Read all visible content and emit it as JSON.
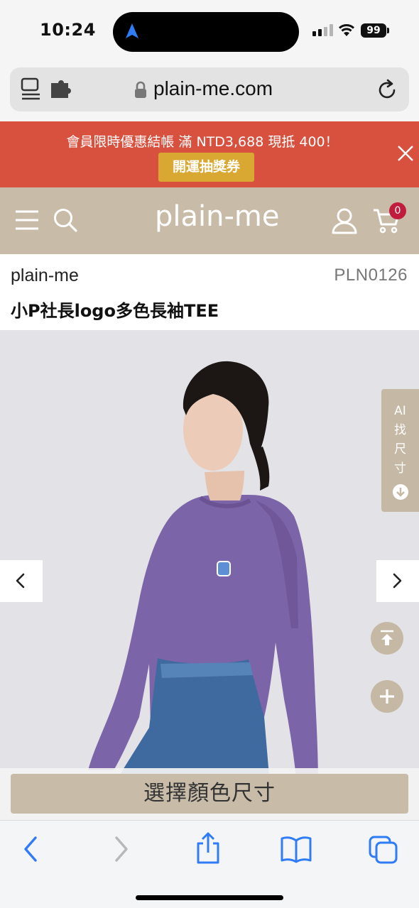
{
  "status_bar": {
    "time": "10:24",
    "battery": "99",
    "icons": [
      "location-arrow-icon",
      "cellular-signal-icon",
      "wifi-icon",
      "battery-icon"
    ]
  },
  "browser": {
    "url": "plain-me.com",
    "icons": [
      "reader-mode-icon",
      "extension-icon",
      "lock-icon",
      "reload-icon"
    ]
  },
  "promo": {
    "text": "會員限時優惠結帳 滿 NTD3,688 現抵 400！",
    "button_label": "開運抽獎券",
    "background": "#d8513e",
    "button_color": "#d9a832"
  },
  "header": {
    "logo": "plain-me",
    "cart_count": "0",
    "background": "#c8bca9",
    "badge_color": "#c21c3c"
  },
  "product": {
    "brand": "plain-me",
    "sku": "PLN0126",
    "name": "小P社長logo多色長袖TEE",
    "shirt_color": "#7c64a8"
  },
  "gallery": {
    "ai_size_tab": [
      "AI",
      "找",
      "尺",
      "寸"
    ]
  },
  "cta": {
    "select_label": "選擇顏色尺寸"
  },
  "toolbar": {
    "items": [
      "back-icon",
      "forward-icon",
      "share-icon",
      "bookmarks-icon",
      "tabs-icon"
    ]
  }
}
